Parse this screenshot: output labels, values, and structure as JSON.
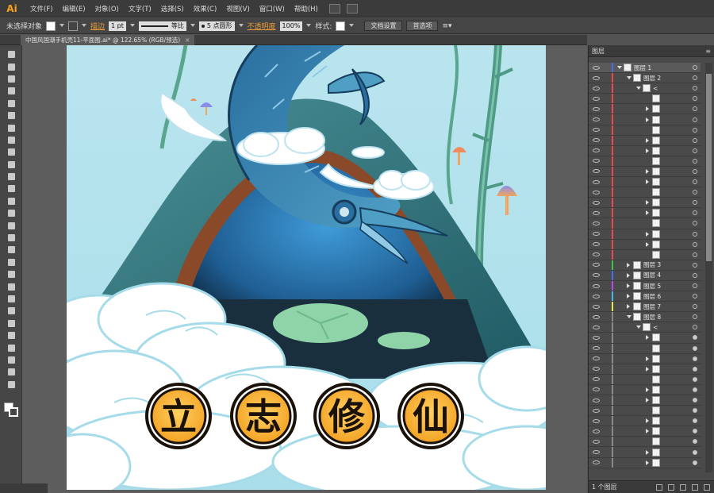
{
  "app": {
    "logo": "Ai"
  },
  "menu": [
    "文件(F)",
    "编辑(E)",
    "对象(O)",
    "文字(T)",
    "选择(S)",
    "效果(C)",
    "视图(V)",
    "窗口(W)",
    "帮助(H)"
  ],
  "control_bar": {
    "selection_status": "未选择对象",
    "stroke_label": "描边",
    "stroke_weight": "1 pt",
    "profile": "等比",
    "brush": "5 点圆形",
    "opacity_label": "不透明度",
    "opacity_value": "100%",
    "style_label": "样式:",
    "doc_setup": "文档设置",
    "preferences": "首选项"
  },
  "document_tab": {
    "title": "中国风国潮手机壳11-平面图.ai* @ 122.65% (RGB/预选)",
    "close": "×"
  },
  "artwork": {
    "characters": [
      "立",
      "志",
      "修",
      "仙"
    ]
  },
  "layers_panel": {
    "title": "图层",
    "rows": [
      {
        "name": "图层 1",
        "level": 0,
        "expanded": true,
        "color": "#3f6fe8"
      },
      {
        "name": "图层 2",
        "level": 1,
        "expanded": true,
        "color": "#e84a4a"
      },
      {
        "name": "<",
        "level": 2,
        "expanded": true,
        "color": "#e84a4a"
      },
      {
        "name": "",
        "level": 3,
        "color": "#e84a4a"
      },
      {
        "name": "",
        "level": 3,
        "color": "#e84a4a"
      },
      {
        "name": "",
        "level": 3,
        "color": "#e84a4a"
      },
      {
        "name": "",
        "level": 3,
        "color": "#e84a4a"
      },
      {
        "name": "",
        "level": 3,
        "color": "#e84a4a"
      },
      {
        "name": "",
        "level": 3,
        "color": "#e84a4a"
      },
      {
        "name": "",
        "level": 3,
        "color": "#e84a4a"
      },
      {
        "name": "",
        "level": 3,
        "color": "#e84a4a"
      },
      {
        "name": "",
        "level": 3,
        "color": "#e84a4a"
      },
      {
        "name": "",
        "level": 3,
        "color": "#e84a4a"
      },
      {
        "name": "",
        "level": 3,
        "color": "#e84a4a"
      },
      {
        "name": "",
        "level": 3,
        "color": "#e84a4a"
      },
      {
        "name": "",
        "level": 3,
        "color": "#e84a4a"
      },
      {
        "name": "",
        "level": 3,
        "color": "#e84a4a"
      },
      {
        "name": "",
        "level": 3,
        "color": "#e84a4a"
      },
      {
        "name": "",
        "level": 3,
        "color": "#e84a4a"
      },
      {
        "name": "图层 3",
        "level": 1,
        "color": "#3ec24a"
      },
      {
        "name": "图层 4",
        "level": 1,
        "color": "#4a6ee8"
      },
      {
        "name": "图层 5",
        "level": 1,
        "color": "#b84ae8"
      },
      {
        "name": "图层 6",
        "level": 1,
        "color": "#4ab8e8"
      },
      {
        "name": "图层 7",
        "level": 1,
        "color": "#e8e84a"
      },
      {
        "name": "图层 8",
        "level": 1,
        "expanded": true,
        "color": "#8a8a8a"
      },
      {
        "name": "<",
        "level": 2,
        "expanded": true,
        "color": "#8a8a8a"
      },
      {
        "name": "",
        "level": 3,
        "color": "#8a8a8a"
      },
      {
        "name": "",
        "level": 3,
        "color": "#8a8a8a"
      },
      {
        "name": "",
        "level": 3,
        "color": "#8a8a8a"
      },
      {
        "name": "",
        "level": 3,
        "color": "#8a8a8a"
      },
      {
        "name": "",
        "level": 3,
        "color": "#8a8a8a"
      },
      {
        "name": "",
        "level": 3,
        "color": "#8a8a8a"
      },
      {
        "name": "",
        "level": 3,
        "color": "#8a8a8a"
      },
      {
        "name": "",
        "level": 3,
        "color": "#8a8a8a"
      },
      {
        "name": "",
        "level": 3,
        "color": "#8a8a8a"
      },
      {
        "name": "",
        "level": 3,
        "color": "#8a8a8a"
      },
      {
        "name": "",
        "level": 3,
        "color": "#8a8a8a"
      },
      {
        "name": "",
        "level": 3,
        "color": "#8a8a8a"
      },
      {
        "name": "",
        "level": 3,
        "color": "#8a8a8a"
      }
    ],
    "footer": "1 个图层"
  },
  "tools": [
    "selection-tool",
    "direct-selection-tool",
    "magic-wand-tool",
    "lasso-tool",
    "pen-tool",
    "type-tool",
    "line-tool",
    "rectangle-tool",
    "paintbrush-tool",
    "pencil-tool",
    "blob-brush-tool",
    "eraser-tool",
    "rotate-tool",
    "scale-tool",
    "width-tool",
    "free-transform-tool",
    "shape-builder-tool",
    "perspective-grid-tool",
    "mesh-tool",
    "gradient-tool",
    "eyedropper-tool",
    "blend-tool",
    "symbol-sprayer-tool",
    "column-graph-tool",
    "artboard-tool",
    "slice-tool",
    "hand-tool",
    "zoom-tool"
  ]
}
